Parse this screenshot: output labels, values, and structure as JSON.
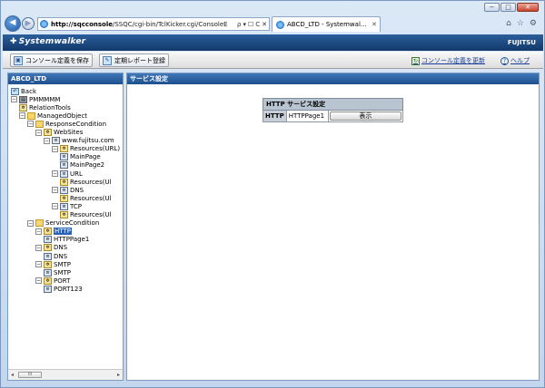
{
  "browser": {
    "address_url_host": "http://sqcconsole",
    "address_url_path": "/SSQC/cgi-bin/TclKicker.cgi/ConsoleE",
    "address_tools": [
      "ρ",
      "▾",
      "☐",
      "C",
      "✕"
    ],
    "tab_title": "ABCD_LTD - Systemwal...",
    "tab_close": "✕",
    "window_buttons": [
      "−",
      "□",
      "✕"
    ],
    "right_icons": [
      "⌂",
      "☆",
      "⚙"
    ]
  },
  "app": {
    "brand": "Systemwalker",
    "vendor": "FUJITSU"
  },
  "toolbar": {
    "save_label": "コンソール定義を保存",
    "report_label": "定期レポート登録",
    "update_label": "コンソール定義を更新",
    "help_label": "ヘルプ"
  },
  "left_panel": {
    "title": "ABCD_LTD",
    "tree": [
      {
        "id": "back",
        "label": "Back",
        "level": 0,
        "toggle": "",
        "icon": "back"
      },
      {
        "id": "pmmmmm",
        "label": "PMMMMM",
        "level": 0,
        "toggle": "−",
        "icon": "server"
      },
      {
        "id": "relationtools",
        "label": "RelationTools",
        "level": 1,
        "toggle": "",
        "icon": "gear"
      },
      {
        "id": "managedobject",
        "label": "ManagedObject",
        "level": 1,
        "toggle": "−",
        "icon": "folder"
      },
      {
        "id": "responsecondition",
        "label": "ResponseCondition",
        "level": 2,
        "toggle": "−",
        "icon": "folder"
      },
      {
        "id": "websites",
        "label": "WebSites",
        "level": 3,
        "toggle": "−",
        "icon": "gear"
      },
      {
        "id": "fujitsu",
        "label": "www.fujitsu.com",
        "level": 4,
        "toggle": "−",
        "icon": "page"
      },
      {
        "id": "resources-url",
        "label": "Resources(URL)",
        "level": 5,
        "toggle": "−",
        "icon": "gear"
      },
      {
        "id": "mainpage",
        "label": "MainPage",
        "level": 6,
        "toggle": "",
        "icon": "page"
      },
      {
        "id": "mainpage2",
        "label": "MainPage2",
        "level": 6,
        "toggle": "",
        "icon": "page"
      },
      {
        "id": "url",
        "label": "URL",
        "level": 5,
        "toggle": "−",
        "icon": "page"
      },
      {
        "id": "resources-url2",
        "label": "Resources(Ul",
        "level": 6,
        "toggle": "",
        "icon": "gear"
      },
      {
        "id": "dns-site",
        "label": "DNS",
        "level": 5,
        "toggle": "−",
        "icon": "page"
      },
      {
        "id": "resources-dns",
        "label": "Resources(Ul",
        "level": 6,
        "toggle": "",
        "icon": "gear"
      },
      {
        "id": "tcp",
        "label": "TCP",
        "level": 5,
        "toggle": "−",
        "icon": "page"
      },
      {
        "id": "resources-tcp",
        "label": "Resources(Ul",
        "level": 6,
        "toggle": "",
        "icon": "gear"
      },
      {
        "id": "servicecondition",
        "label": "ServiceCondition",
        "level": 2,
        "toggle": "−",
        "icon": "folder"
      },
      {
        "id": "http",
        "label": "HTTP",
        "level": 3,
        "toggle": "−",
        "icon": "gear",
        "selected": true
      },
      {
        "id": "httppage1",
        "label": "HTTPPage1",
        "level": 4,
        "toggle": "",
        "icon": "page"
      },
      {
        "id": "dns",
        "label": "DNS",
        "level": 3,
        "toggle": "−",
        "icon": "gear"
      },
      {
        "id": "dns-leaf",
        "label": "DNS",
        "level": 4,
        "toggle": "",
        "icon": "page"
      },
      {
        "id": "smtp",
        "label": "SMTP",
        "level": 3,
        "toggle": "−",
        "icon": "gear"
      },
      {
        "id": "smtp-leaf",
        "label": "SMTP",
        "level": 4,
        "toggle": "",
        "icon": "page"
      },
      {
        "id": "port",
        "label": "PORT",
        "level": 3,
        "toggle": "−",
        "icon": "gear"
      },
      {
        "id": "port123",
        "label": "PORT123",
        "level": 4,
        "toggle": "",
        "icon": "page"
      }
    ],
    "scroll_thumb": "III"
  },
  "main": {
    "title": "サービス設定",
    "table_caption": "HTTP サービス設定",
    "row": {
      "service": "HTTP",
      "page": "HTTPPage1",
      "button_label": "表示"
    }
  }
}
